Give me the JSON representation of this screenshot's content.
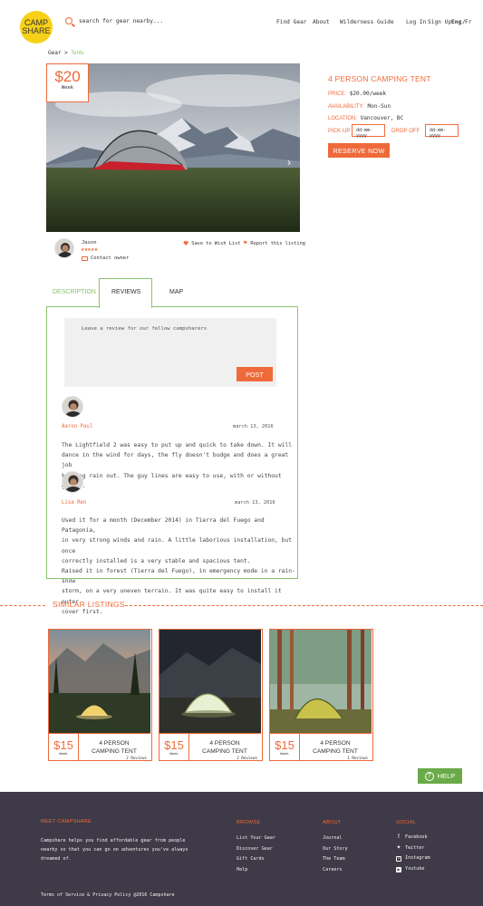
{
  "header": {
    "logo_line1": "CAMP",
    "logo_line2": "SHARE",
    "search_placeholder": "search for gear nearby...",
    "nav": [
      "Find Gear",
      "About",
      "Wilderness Guide"
    ],
    "login": "Log In",
    "signup": "Sign Up",
    "lang_en": "Eng",
    "lang_sep": "/",
    "lang_fr": "Fr"
  },
  "breadcrumb": {
    "root": "Gear",
    "sep": " > ",
    "current": "Tents"
  },
  "listing": {
    "price": "$20",
    "price_unit": "Week",
    "title": "4 PERSON CAMPING TENT",
    "price_label": "PRICE:",
    "price_value": "$20.00/week",
    "availability_label": "AVAILABILITY:",
    "availability_value": "Mon-Sun",
    "location_label": "LOCATION:",
    "location_value": "Vancouver, BC",
    "pickup_label": "PICK UP",
    "dropoff_label": "DROP OFF",
    "date_placeholder": "dd-mm-yyyy",
    "reserve_label": "RESERVE NOW",
    "next_arrow": "›"
  },
  "owner": {
    "name": "Jason",
    "rating_stars": "★★★★★",
    "rating": 5,
    "contact": "Contact owner",
    "wishlist": "Save to Wish List",
    "report": "Report this listing"
  },
  "tabs": [
    "DESCRIPTION",
    "REVIEWS",
    "MAP"
  ],
  "active_tab": "REVIEWS",
  "reviews": {
    "placeholder": "Leave a review for our fellow campsharers",
    "post_label": "POST",
    "items": [
      {
        "name": "Aaron Paul",
        "date": "march 13, 2016",
        "text": [
          "The Lightfield 2 was easy to put up and quick to take down. It will",
          "dance in the wind for days, the fly doesn't budge and does a great job",
          "keeping rain out. The guy lines are easy to use, with or without gloves."
        ]
      },
      {
        "name": "Lisa Ren",
        "date": "march 13, 2016",
        "text": [
          "Used it for a month (December 2014) in Tierra del Fuego and Patagonia,",
          "in very strong winds and rain. A little laborious installation, but once",
          "correctly installed is a very stable and spacious tent.",
          "Raised it in forest (Tierra del Fuego), in emergency mode in a rain-snow",
          "storm, on a very uneven terrain. It was quite easy to install it outer",
          "cover first."
        ]
      }
    ]
  },
  "similar": {
    "title": "SIMILAR LISTINGS",
    "cards": [
      {
        "price": "$15",
        "unit": "Week",
        "name_line1": "4 PERSON",
        "name_line2": "CAMPING TENT",
        "reviews": "2 Reviews"
      },
      {
        "price": "$15",
        "unit": "Week",
        "name_line1": "4 PERSON",
        "name_line2": "CAMPING TENT",
        "reviews": "2 Reviews"
      },
      {
        "price": "$15",
        "unit": "Week",
        "name_line1": "4 PERSON",
        "name_line2": "CAMPING TENT",
        "reviews": "1 Reviews"
      }
    ]
  },
  "help": {
    "label": "HELP",
    "icon": "?"
  },
  "footer": {
    "meet_title": "MEET CAMPSHARE",
    "meet_text": [
      "Campshare helps you find affordable gear from people",
      "nearby so that you can go on adventures you've always",
      "dreamed of."
    ],
    "browse_title": "BROWSE",
    "browse": [
      "List Your Gear",
      "Discover Gear",
      "Gift Cards",
      "Help"
    ],
    "about_title": "ABOUT",
    "about": [
      "Journal",
      "Our Story",
      "The Team",
      "Careers"
    ],
    "social_title": "SOCIAL",
    "social": [
      "Facebook",
      "Twitter",
      "Instagram",
      "Youtube"
    ],
    "legal": "Terms of Service & Privacy Policy @2016 Campshare"
  },
  "colors": {
    "accent": "#ef6a3a",
    "green": "#8ac36e",
    "help_green": "#6aaa48",
    "footer_bg": "#3e3a47",
    "logo_yellow": "#f7d117"
  },
  "icons": [
    "search-icon",
    "heart-icon",
    "flag-icon",
    "envelope-icon",
    "chevron-right-icon",
    "facebook-icon",
    "twitter-icon",
    "instagram-icon",
    "youtube-icon",
    "question-icon"
  ]
}
